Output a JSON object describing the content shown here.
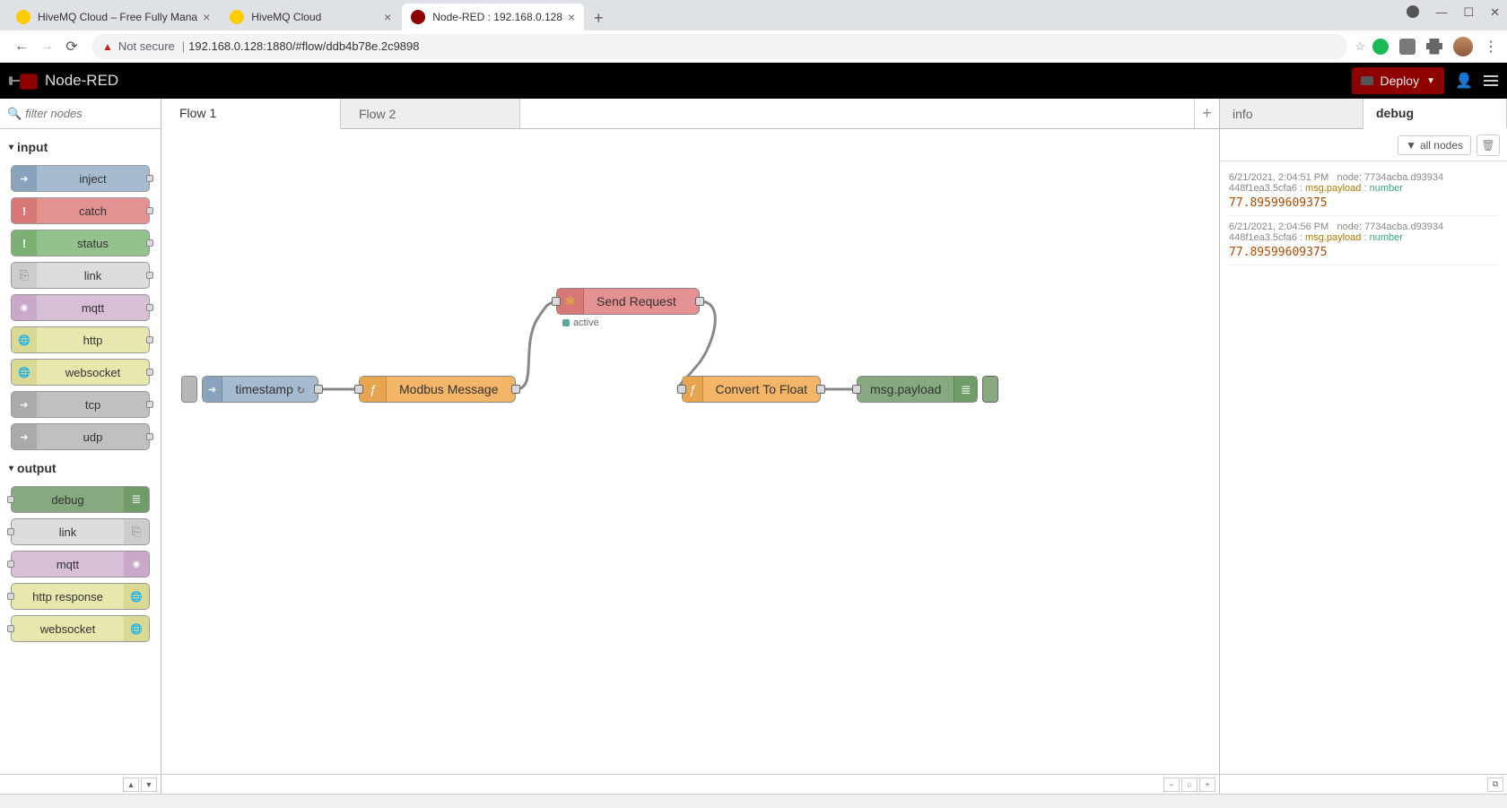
{
  "browser": {
    "tabs": [
      {
        "title": "HiveMQ Cloud – Free Fully Mana"
      },
      {
        "title": "HiveMQ Cloud"
      },
      {
        "title": "Node-RED : 192.168.0.128"
      }
    ],
    "not_secure": "Not secure",
    "url": "192.168.0.128:1880/#flow/ddb4b78e.2c9898"
  },
  "header": {
    "title": "Node-RED",
    "deploy": "Deploy"
  },
  "palette": {
    "filter_placeholder": "filter nodes",
    "cat_input": "input",
    "cat_output": "output",
    "nodes_in": {
      "inject": "inject",
      "catch": "catch",
      "status": "status",
      "link": "link",
      "mqtt": "mqtt",
      "http": "http",
      "websocket": "websocket",
      "tcp": "tcp",
      "udp": "udp"
    },
    "nodes_out": {
      "debug": "debug",
      "link": "link",
      "mqtt": "mqtt",
      "http_response": "http response",
      "websocket": "websocket"
    }
  },
  "workspace": {
    "tabs": {
      "flow1": "Flow 1",
      "flow2": "Flow 2"
    },
    "nodes": {
      "timestamp": "timestamp",
      "modbus": "Modbus Message",
      "send": "Send Request",
      "send_status": "active",
      "convert": "Convert To Float",
      "debug": "msg.payload"
    }
  },
  "sidebar": {
    "tab_info": "info",
    "tab_debug": "debug",
    "filter_label": "all nodes",
    "messages": [
      {
        "time": "6/21/2021, 2:04:51 PM",
        "node": "node: 7734acba.d93934",
        "topic": "448f1ea3.5cfa6",
        "path": "msg.payload",
        "type": "number",
        "value": "77.89599609375"
      },
      {
        "time": "6/21/2021, 2:04:56 PM",
        "node": "node: 7734acba.d93934",
        "topic": "448f1ea3.5cfa6",
        "path": "msg.payload",
        "type": "number",
        "value": "77.89599609375"
      }
    ]
  }
}
